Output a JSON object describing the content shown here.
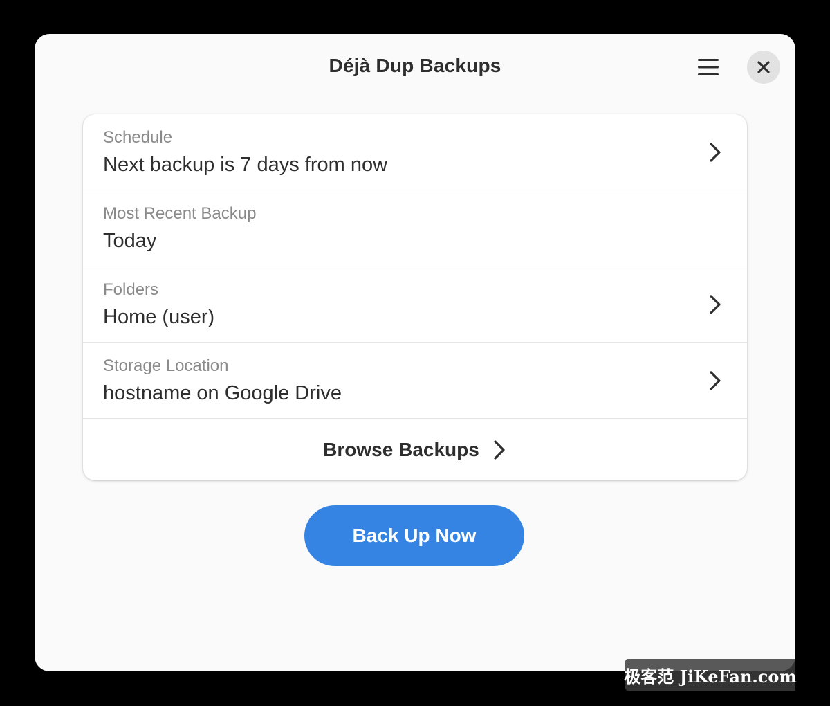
{
  "window": {
    "title": "Déjà Dup Backups"
  },
  "header": {
    "menu_icon": "hamburger-menu-icon",
    "close_icon": "close-icon"
  },
  "rows": [
    {
      "subtitle": "Schedule",
      "title": "Next backup is 7 days from now",
      "has_chevron": true
    },
    {
      "subtitle": "Most Recent Backup",
      "title": "Today",
      "has_chevron": false
    },
    {
      "subtitle": "Folders",
      "title": "Home (user)",
      "has_chevron": true
    },
    {
      "subtitle": "Storage Location",
      "title": "hostname on Google Drive",
      "has_chevron": true
    }
  ],
  "browse": {
    "label": "Browse Backups",
    "icon": "chevron-right-icon"
  },
  "primary_action": {
    "label": "Back Up Now"
  },
  "watermark": {
    "text": "极客范 JiKeFan.com"
  },
  "colors": {
    "accent": "#3584e4",
    "window_bg": "#fafafa",
    "card_bg": "#ffffff",
    "text_primary": "#2e2e2e",
    "text_secondary": "#8a8a8a"
  }
}
